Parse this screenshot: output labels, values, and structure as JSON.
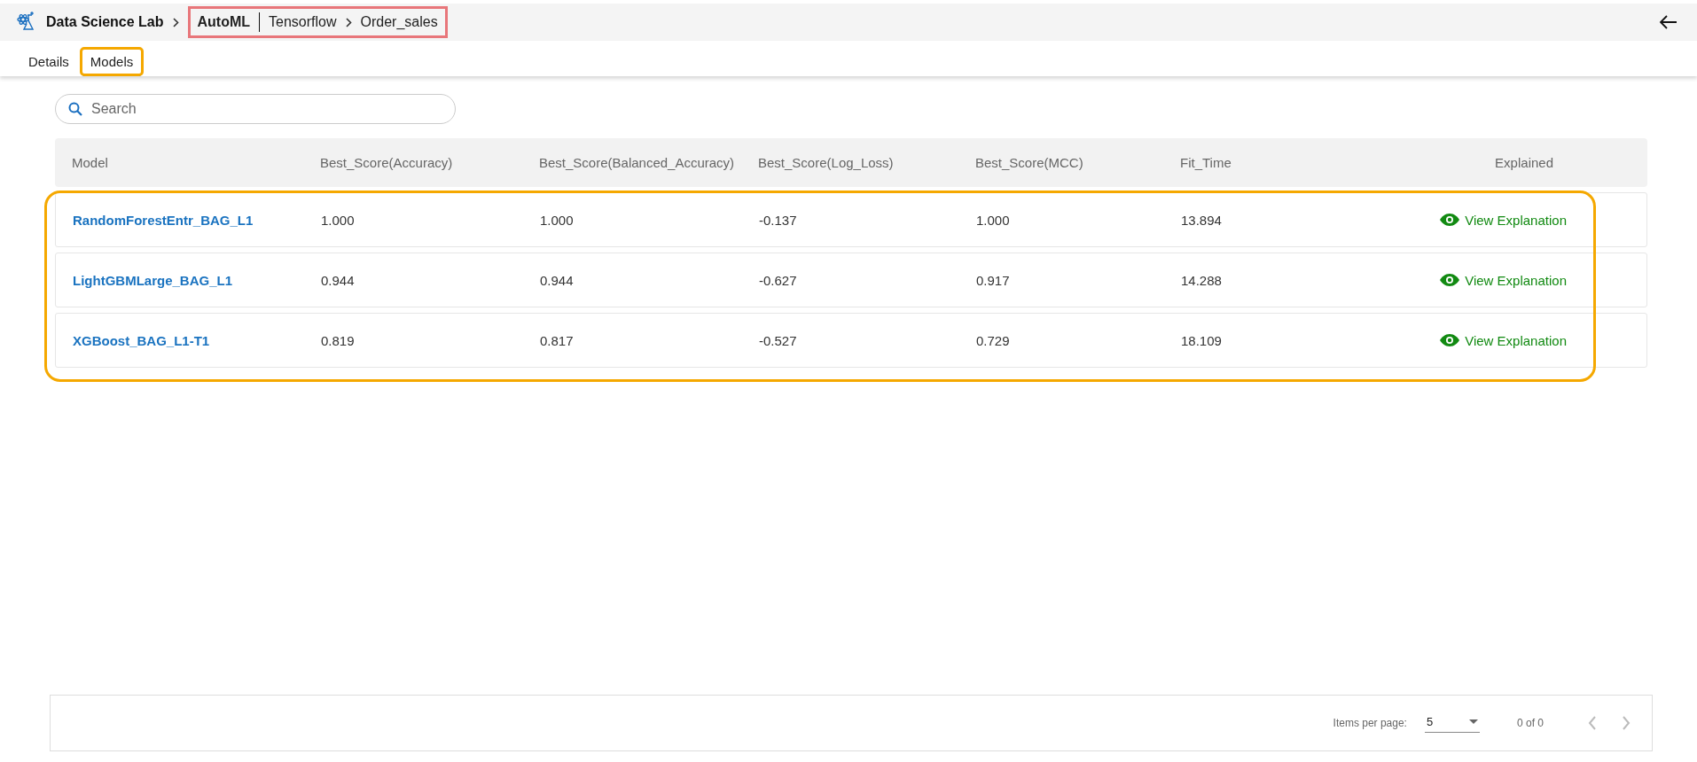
{
  "header": {
    "app_name": "Data Science Lab",
    "breadcrumb": {
      "highlighted": true,
      "items": [
        "AutoML",
        "Tensorflow",
        "Order_sales"
      ]
    }
  },
  "tabs": [
    {
      "label": "Details",
      "selected": false,
      "highlighted": false
    },
    {
      "label": "Models",
      "selected": true,
      "highlighted": true
    }
  ],
  "search": {
    "placeholder": "Search"
  },
  "table": {
    "columns": [
      "Model",
      "Best_Score(Accuracy)",
      "Best_Score(Balanced_Accuracy)",
      "Best_Score(Log_Loss)",
      "Best_Score(MCC)",
      "Fit_Time",
      "Explained"
    ],
    "rows_highlighted": true,
    "rows": [
      {
        "model": "RandomForestEntr_BAG_L1",
        "values": [
          "1.000",
          "1.000",
          "-0.137",
          "1.000",
          "13.894"
        ],
        "action": "View Explanation"
      },
      {
        "model": "LightGBMLarge_BAG_L1",
        "values": [
          "0.944",
          "0.944",
          "-0.627",
          "0.917",
          "14.288"
        ],
        "action": "View Explanation"
      },
      {
        "model": "XGBoost_BAG_L1-T1",
        "values": [
          "0.819",
          "0.817",
          "-0.527",
          "0.729",
          "18.109"
        ],
        "action": "View Explanation"
      }
    ]
  },
  "paginator": {
    "label": "Items per page:",
    "page_size": "5",
    "range": "0 of 0"
  }
}
